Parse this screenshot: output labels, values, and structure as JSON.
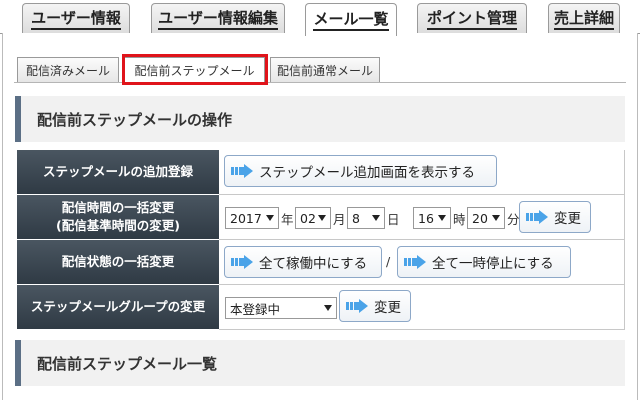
{
  "main_tabs": [
    {
      "label": "ユーザー情報",
      "active": false
    },
    {
      "label": "ユーザー情報編集",
      "active": false
    },
    {
      "label": "メール一覧",
      "active": true
    },
    {
      "label": "ポイント管理",
      "active": false
    },
    {
      "label": "売上詳細",
      "active": false
    }
  ],
  "sub_tabs": [
    {
      "label": "配信済みメール",
      "active": false
    },
    {
      "label": "配信前ステップメール",
      "active": true
    },
    {
      "label": "配信前通常メール",
      "active": false
    }
  ],
  "sections": {
    "operations_title": "配信前ステップメールの操作",
    "list_title": "配信前ステップメール一覧"
  },
  "rows": {
    "add": {
      "label": "ステップメールの追加登録",
      "button": "ステップメール追加画面を表示する"
    },
    "time_change": {
      "label_line1": "配信時間の一括変更",
      "label_line2": "(配信基準時間の変更)",
      "year": "2017",
      "year_unit": "年",
      "month": "02",
      "month_unit": "月",
      "day": "8",
      "day_unit": "日",
      "hour": "16",
      "hour_unit": "時",
      "minute": "20",
      "minute_unit": "分",
      "button": "変更"
    },
    "status_change": {
      "label": "配信状態の一括変更",
      "button_all_active": "全て稼働中にする",
      "separator": "/",
      "button_all_pause": "全て一時停止にする"
    },
    "group_change": {
      "label": "ステップメールグループの変更",
      "group_value": "本登録中",
      "button": "変更"
    }
  },
  "colors": {
    "label_bg": "#3a4651",
    "highlight": "#e0141b",
    "arrow": "#4aa3e8",
    "section_accent": "#5b6f85"
  }
}
